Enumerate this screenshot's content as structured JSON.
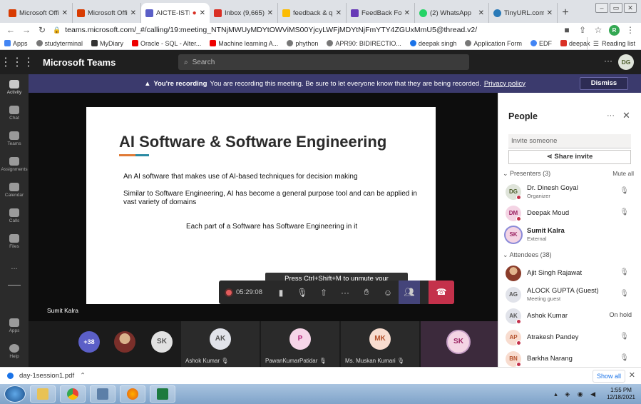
{
  "browser": {
    "tabs": [
      {
        "title": "Microsoft Office",
        "favicon_color": "#d83b01",
        "active": false
      },
      {
        "title": "Microsoft Office",
        "favicon_color": "#d83b01",
        "active": false
      },
      {
        "title": "AICTE-ISTE",
        "favicon_color": "#5b5fc7",
        "active": true
      },
      {
        "title": "Inbox (9,665) -",
        "favicon_color": "#d93025",
        "active": false
      },
      {
        "title": "feedback & quiz",
        "favicon_color": "#fbbc04",
        "active": false
      },
      {
        "title": "FeedBack Form",
        "favicon_color": "#673ab7",
        "active": false
      },
      {
        "title": "(2) WhatsApp",
        "favicon_color": "#25d366",
        "active": false
      },
      {
        "title": "TinyURL.com -",
        "favicon_color": "#2a7ab8",
        "active": false
      }
    ],
    "new_tab": "+",
    "url": "teams.microsoft.com/_#/calling/19:meeting_NTNjMWUyMDYtOWViMS00YjcyLWFjMDYtNjFmYTY4ZGUxMmU5@thread.v2/",
    "profile_initial": "R",
    "bookmarks": [
      "Apps",
      "studyterminal",
      "MyDiary",
      "Oracle - SQL - Alter...",
      "Machine learning A...",
      "phython",
      "APR90: BIDIRECTIO...",
      "deepak singh",
      "Application Form",
      "EDF",
      "deepak"
    ],
    "reading_list": "Reading list"
  },
  "teams": {
    "app_name": "Microsoft Teams",
    "search_placeholder": "Search",
    "user_initials": "DG",
    "rail": [
      {
        "label": "Activity",
        "active": true
      },
      {
        "label": "Chat",
        "active": false
      },
      {
        "label": "Teams",
        "active": false
      },
      {
        "label": "Assignments",
        "active": false
      },
      {
        "label": "Calendar",
        "active": false
      },
      {
        "label": "Calls",
        "active": false
      },
      {
        "label": "Files",
        "active": false
      },
      {
        "label": "...",
        "active": false
      }
    ],
    "rail_bottom": [
      {
        "label": "Apps"
      },
      {
        "label": "Help"
      }
    ]
  },
  "banner": {
    "bold": "You're recording",
    "text": "You are recording this meeting. Be sure to let everyone know that they are being recorded.",
    "link": "Privacy policy",
    "dismiss": "Dismiss"
  },
  "slide": {
    "title": "AI Software  & Software Engineering",
    "line1": "An AI software that makes use of AI-based techniques for decision making",
    "line2": "Similar to Software Engineering, AI has become a general purpose tool and can be applied in vast variety of domains",
    "line3": "Each part of a Software has Software Engineering in it"
  },
  "stage": {
    "presenter_name": "Sumit Kalra",
    "tooltip": "Press Ctrl+Shift+M to unmute your microphone.",
    "timer": "05:29:08"
  },
  "tiles": [
    {
      "initials": "+38",
      "name": "",
      "color": "#5b5fc7",
      "text_color": "#ffffff"
    },
    {
      "initials": "",
      "name": "",
      "color": "#d9b38c",
      "text_color": "#222222"
    },
    {
      "initials": "SK",
      "name": "",
      "color": "#e1e1e1",
      "text_color": "#555555"
    },
    {
      "initials": "AK",
      "name": "Ashok Kumar",
      "color": "#e1e3ea",
      "text_color": "#555555"
    },
    {
      "initials": "P",
      "name": "PawanKumarPatidar",
      "color": "#f6d5e8",
      "text_color": "#b4237a"
    },
    {
      "initials": "MK",
      "name": "Ms. Muskan Kumari",
      "color": "#f8dccf",
      "text_color": "#b4502a"
    },
    {
      "initials": "SK",
      "name": "",
      "color": "#f4d4e4",
      "text_color": "#9b2463"
    }
  ],
  "people": {
    "title": "People",
    "invite_placeholder": "Invite someone",
    "share_invite": "Share invite",
    "presenters_label": "Presenters (3)",
    "mute_all": "Mute all",
    "attendees_label": "Attendees (38)",
    "presenters": [
      {
        "initials": "DG",
        "name": "Dr. Dinesh Goyal",
        "sub": "Organizer",
        "bg": "#dfe4da",
        "fg": "#4b5c2a",
        "status": "mute"
      },
      {
        "initials": "DM",
        "name": "Deepak Moud",
        "sub": "",
        "bg": "#f4d4e4",
        "fg": "#9b2463",
        "status": "mute"
      },
      {
        "initials": "SK",
        "name": "Sumit Kalra",
        "sub": "External",
        "bg": "#f4d4e4",
        "fg": "#9b2463",
        "status": ""
      }
    ],
    "attendees": [
      {
        "initials": "",
        "name": "Ajit Singh Rajawat",
        "sub": "",
        "bg": "#8a5a3c",
        "fg": "#ffffff",
        "status": "mute"
      },
      {
        "initials": "AG",
        "name": "ALOCK GUPTA (Guest)",
        "sub": "Meeting guest",
        "bg": "#e1e3ea",
        "fg": "#555555",
        "status": "mute"
      },
      {
        "initials": "AK",
        "name": "Ashok Kumar",
        "sub": "",
        "bg": "#e1e3ea",
        "fg": "#555555",
        "status": "On hold"
      },
      {
        "initials": "AP",
        "name": "Atrakesh Pandey",
        "sub": "",
        "bg": "#f8dccf",
        "fg": "#b4502a",
        "status": "mute"
      },
      {
        "initials": "BN",
        "name": "Barkha Narang",
        "sub": "",
        "bg": "#f8dccf",
        "fg": "#b4502a",
        "status": "mute"
      }
    ]
  },
  "download": {
    "file": "day-1session1.pdf",
    "show_all": "Show all"
  },
  "taskbar": {
    "time": "1:55 PM",
    "date": "12/18/2021"
  }
}
